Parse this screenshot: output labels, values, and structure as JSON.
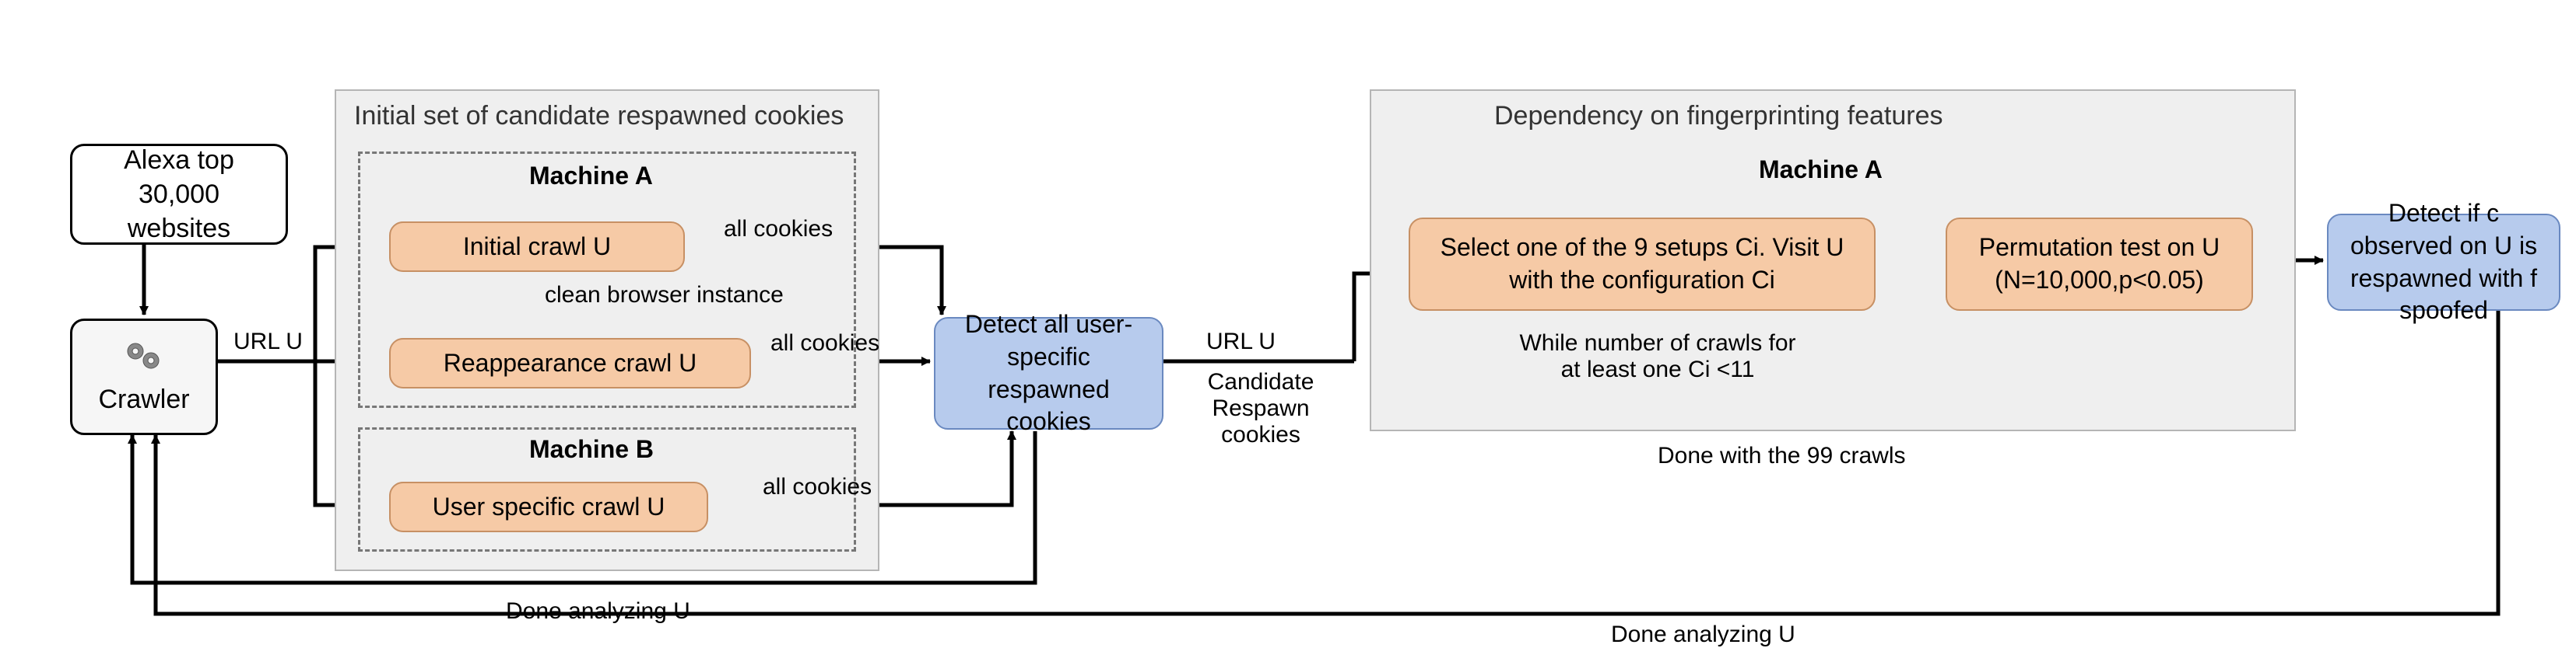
{
  "input": {
    "alexa": "Alexa top 30,000 websites",
    "crawler": "Crawler"
  },
  "phase1": {
    "title": "Initial set of candidate respawned cookies",
    "machineA": {
      "title": "Machine A",
      "initial_crawl": "Initial crawl U",
      "clean_instance": "clean browser instance",
      "reappearance_crawl": "Reappearance crawl U"
    },
    "machineB": {
      "title": "Machine B",
      "user_specific_crawl": "User specific crawl U"
    },
    "detect": "Detect all user-specific respawned cookies"
  },
  "phase2": {
    "title": "Dependency on fingerprinting features",
    "machineA": {
      "title": "Machine A",
      "select_setup": "Select one of the 9 setups Ci. Visit U with the configuration Ci",
      "while_loop": "While number of crawls for at least one Ci <11",
      "permutation": "Permutation test on U (N=10,000,p<0.05)"
    },
    "done_crawls": "Done with the 99 crawls",
    "detect": "Detect if c observed on U is respawned with f spoofed"
  },
  "edges": {
    "url_u_left": "URL U",
    "all_cookies": "all cookies",
    "url_u_right": "URL U",
    "candidate": "Candidate Respawn cookies",
    "done_analyzing_u": "Done analyzing U"
  }
}
